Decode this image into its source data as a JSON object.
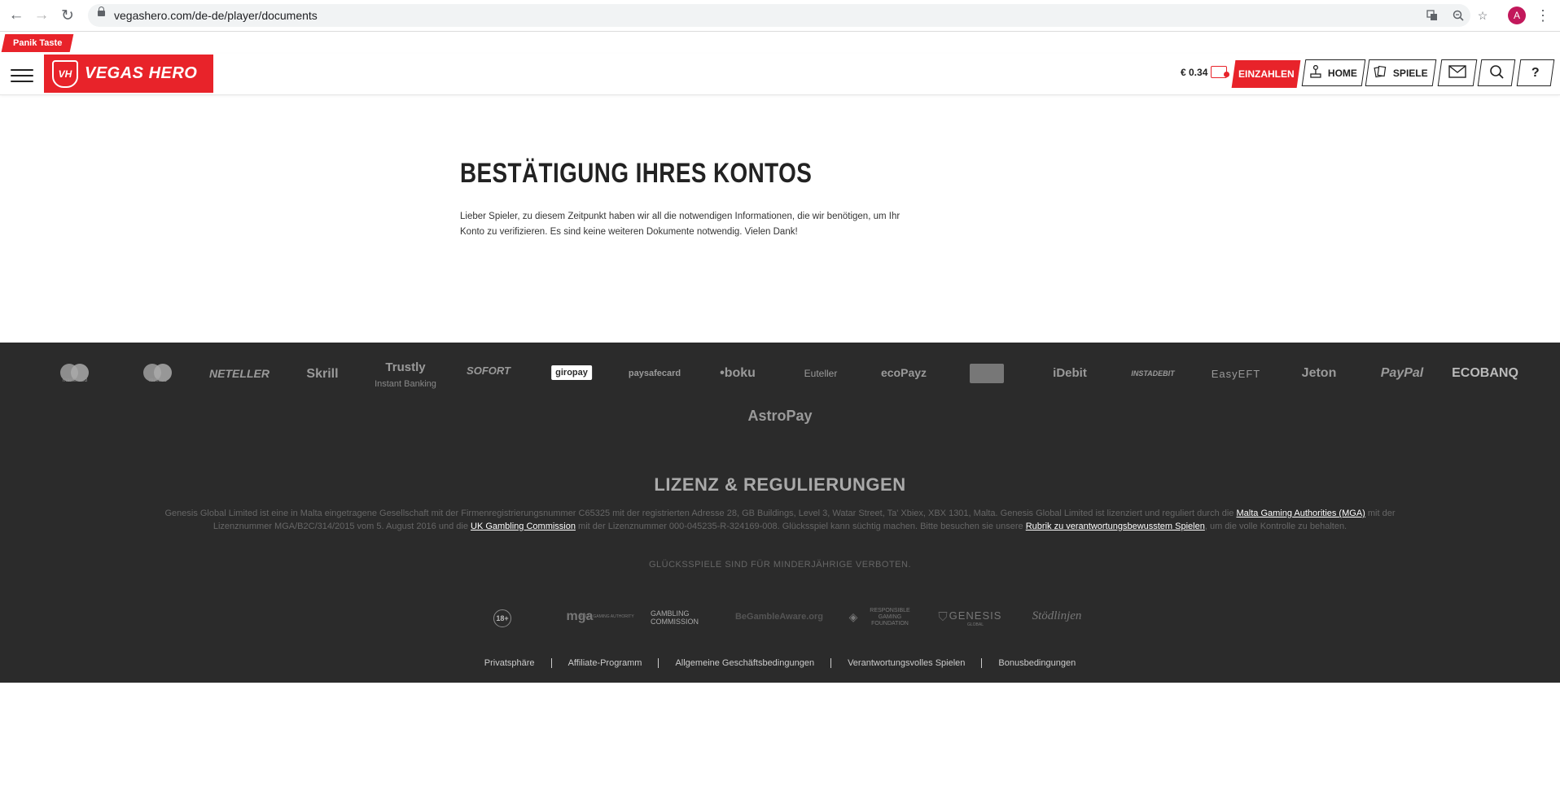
{
  "browser": {
    "url": "vegashero.com/de-de/player/documents",
    "avatar_letter": "A"
  },
  "header": {
    "panic_label": "Panik Taste",
    "logo_badge": "VH",
    "logo_text": "VEGAS HERO",
    "balance": "€ 0.34",
    "deposit_label": "EINZAHLEN",
    "home_label": "HOME",
    "games_label": "SPIELE",
    "help_label": "?"
  },
  "main": {
    "title": "BESTÄTIGUNG IHRES KONTOS",
    "text": "Lieber Spieler, zu diesem Zeitpunkt haben wir all die notwendigen Informationen, die wir benötigen, um Ihr Konto zu verifizieren. Es sind keine weiteren Dokumente notwendig. Vielen Dank!"
  },
  "payments": {
    "mastercard": "mastercard",
    "maestro": "maestro",
    "neteller": "NETELLER",
    "skrill": "Skrill",
    "trustly": "Trustly",
    "trustly_sub": "Instant Banking",
    "sofort": "SOFORT",
    "giropay": "giropay",
    "paysafecard": "paysafecard",
    "boku": "•boku",
    "euteller": "Euteller",
    "ecopayz": "ecoPayz",
    "idebit": "iDebit",
    "instadebit": "INSTADEBIT",
    "easyeft": "EasyEFT",
    "jeton": "Jeton",
    "paypal": "PayPal",
    "ecobanq": "ECOBANQ",
    "astropay": "AstroPay"
  },
  "footer": {
    "license_title": "LIZENZ & REGULIERUNGEN",
    "license_text_1": "Genesis Global Limited ist eine in Malta eingetragene Gesellschaft mit der Firmenregistrierungsnummer C65325 mit der registrierten Adresse 28, GB Buildings, Level 3, Watar Street, Ta' Xbiex, XBX 1301, Malta. Genesis Global Limited ist lizenziert und reguliert durch die ",
    "license_link_mga": "Malta Gaming Authorities (MGA)",
    "license_text_2": " mit der Lizenznummer MGA/B2C/314/2015 vom 5. August 2016 und die ",
    "license_link_ukgc": "UK Gambling Commission",
    "license_text_3": " mit der Lizenznummer 000-045235-R-324169-008. Glücksspiel kann süchtig machen. Bitte besuchen sie unsere ",
    "license_link_rg": "Rubrik zu verantwortungsbewusstem Spielen",
    "license_text_4": ", um die volle Kontrolle zu behalten.",
    "minors_notice": "GLÜCKSSPIELE SIND FÜR MINDERJÄHRIGE VERBOTEN.",
    "badge_18": "18+",
    "mga_logo": "mga",
    "mga_sub": "MALTA GAMING AUTHORITY",
    "gambling_commission": "GAMBLING COMMISSION",
    "begambleaware": "BeGambleAware.org",
    "rgf": "RESPONSIBLE GAMING FOUNDATION",
    "genesis": "GENESIS",
    "genesis_sub": "GLOBAL",
    "stodlinjen": "Stödlinjen",
    "links": [
      "Privatsphäre",
      "Affiliate-Programm",
      "Allgemeine Geschäftsbedingungen",
      "Verantwortungsvolles Spielen",
      "Bonusbedingungen"
    ]
  }
}
